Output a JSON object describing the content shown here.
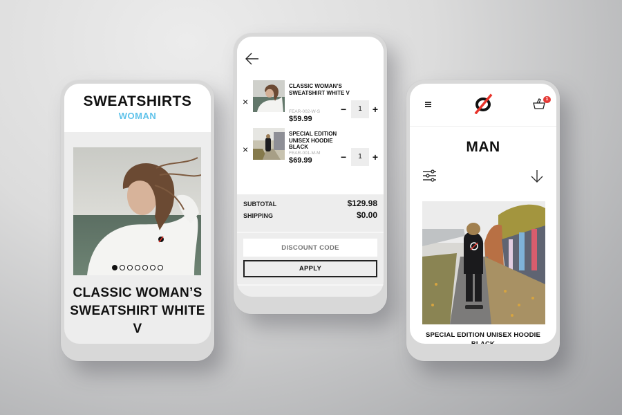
{
  "catalog_screen": {
    "title": "SWEATSHIRTS",
    "subtitle": "WOMAN",
    "carousel": {
      "total_slides": 7,
      "active_slide": 1
    },
    "product_name": "CLASSIC WOMAN’S SWEATSHIRT WHITE V"
  },
  "cart_screen": {
    "back_icon": "arrow-left-icon",
    "items": [
      {
        "name": "CLASSIC WOMAN’S SWEATSHIRT WHITE V",
        "sku": "FEAR-002-W-S",
        "price": "$59.99",
        "quantity": "1",
        "remove_icon": "close-icon"
      },
      {
        "name": "SPECIAL EDITION UNISEX HOODIE BLACK",
        "sku": "FEAR-001-M-M",
        "price": "$69.99",
        "quantity": "1",
        "remove_icon": "close-icon"
      }
    ],
    "qty_minus": "−",
    "qty_plus": "+",
    "remove_label": "×",
    "subtotal_label": "SUBTOTAL",
    "subtotal_value": "$129.98",
    "shipping_label": "SHIPPING",
    "shipping_value": "$0.00",
    "discount_placeholder": "DISCOUNT CODE",
    "apply_label": "APPLY"
  },
  "listing_screen": {
    "menu_icon": "hamburger-icon",
    "logo": "brand-logo-slashed-o",
    "cart_icon": "basket-icon",
    "cart_count": "1",
    "title": "MAN",
    "filter_icon": "sliders-icon",
    "sort_icon": "arrow-down-icon",
    "product_name": "SPECIAL EDITION UNISEX HOODIE BLACK"
  },
  "colors": {
    "accent_blue": "#5ec2ea",
    "badge_red": "#e53935",
    "logo_red": "#e8332a",
    "text_dark": "#111111",
    "panel_gray": "#ededed"
  }
}
